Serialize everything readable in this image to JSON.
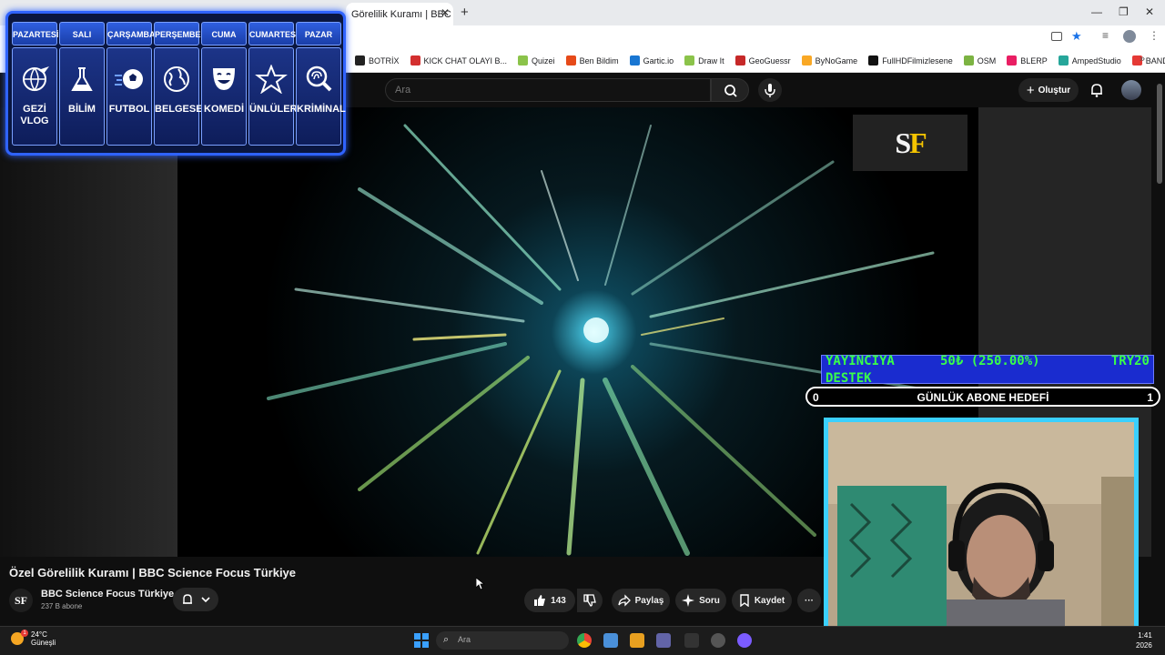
{
  "browser": {
    "tab_title": "Görelilik Kuramı | BBC Scie",
    "new_tab": "+",
    "bookmarks": [
      {
        "label": "BOTRİX",
        "color": "#222222"
      },
      {
        "label": "KICK CHAT OLAYI B...",
        "color": "#d32f2f"
      },
      {
        "label": "Quizei",
        "color": "#8bc34a"
      },
      {
        "label": "Ben Bildim",
        "color": "#e64a19"
      },
      {
        "label": "Gartic.io",
        "color": "#1976d2"
      },
      {
        "label": "Draw It",
        "color": "#8bc34a"
      },
      {
        "label": "GeoGuessr",
        "color": "#c62828"
      },
      {
        "label": "ByNoGame",
        "color": "#f9a825"
      },
      {
        "label": "FullHDFilmizlesene",
        "color": "#111111"
      },
      {
        "label": "OSM",
        "color": "#7cb342"
      },
      {
        "label": "BLERP",
        "color": "#e91e63"
      },
      {
        "label": "AmpedStudio",
        "color": "#26a69a"
      },
      {
        "label": "BANDLAB",
        "color": "#e53935"
      }
    ]
  },
  "youtube": {
    "search_placeholder": "Ara",
    "create_label": "Oluştur",
    "video_title": "Özel Görelilik Kuramı | BBC Science Focus Türkiye",
    "channel_name": "BBC Science Focus Türkiye",
    "subscribers": "237 B abone",
    "channel_avatar_text": "SF",
    "like_count": "143",
    "share_label": "Paylaş",
    "ask_label": "Soru",
    "save_label": "Kaydet",
    "more_label": "···"
  },
  "video_overlay": {
    "logo_s": "S",
    "logo_f": "F"
  },
  "schedule": [
    {
      "day": "PAZARTESİ",
      "label": "GEZİ VLOG",
      "icon": "plane-globe-icon"
    },
    {
      "day": "SALI",
      "label": "BİLİM",
      "icon": "lab-icon"
    },
    {
      "day": "ÇARŞAMBA",
      "label": "FUTBOL",
      "icon": "football-icon"
    },
    {
      "day": "PERŞEMBE",
      "label": "BELGESEL",
      "icon": "globe-icon"
    },
    {
      "day": "CUMA",
      "label": "KOMEDİ",
      "icon": "theater-mask-icon"
    },
    {
      "day": "CUMARTESİ",
      "label": "ÜNLÜLER",
      "icon": "star-icon"
    },
    {
      "day": "PAZAR",
      "label": "KRİMİNAL",
      "icon": "fingerprint-magnifier-icon"
    }
  ],
  "support": {
    "title_line1": "YAYINCIYA",
    "title_line2": "DESTEK",
    "amount": "50₺ (250.00%)",
    "target": "TRY20"
  },
  "goal": {
    "left": "0",
    "label": "GÜNLÜK ABONE HEDEFİ",
    "right": "1"
  },
  "taskbar": {
    "temp": "24°C",
    "weather": "Güneşli",
    "badge": "1",
    "search": "Ara",
    "time": "1:41",
    "date": "2026"
  },
  "colors": {
    "overlay_border": "#2f63ff",
    "support_bg": "#1a2ccf",
    "support_text": "#39ff4a",
    "cam_border": "#3ad0ff"
  }
}
